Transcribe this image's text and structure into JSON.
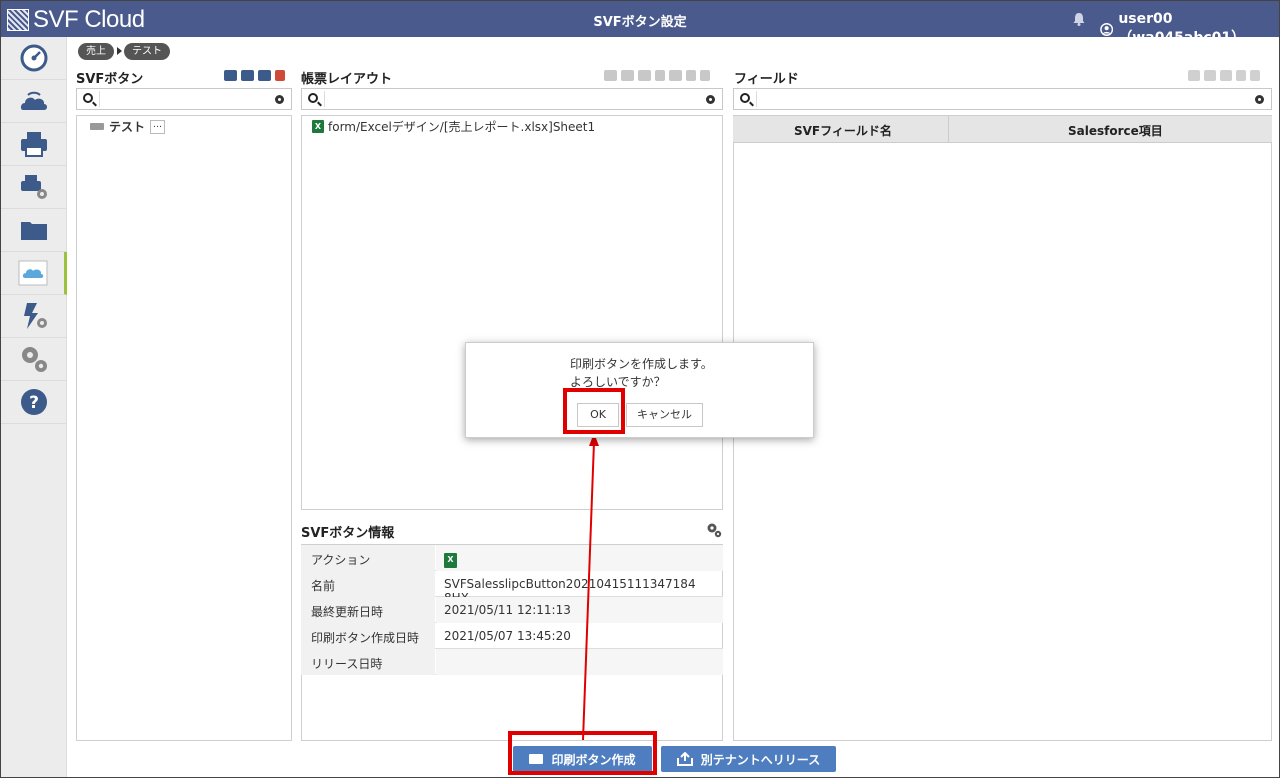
{
  "app": {
    "logo_text": "SVF Cloud",
    "title": "SVFボタン設定",
    "user": "user00（wa045abc01）"
  },
  "nav": {
    "items": [
      {
        "name": "dashboard-icon"
      },
      {
        "name": "cloud-icon"
      },
      {
        "name": "printer-icon"
      },
      {
        "name": "printer-settings-icon"
      },
      {
        "name": "folder-icon"
      },
      {
        "name": "salesforce-icon"
      },
      {
        "name": "flash-settings-icon"
      },
      {
        "name": "gears-icon"
      },
      {
        "name": "help-icon"
      }
    ],
    "active_index": 5
  },
  "breadcrumb": [
    "売上",
    "テスト"
  ],
  "svf_buttons": {
    "title": "SVFボタン",
    "tree_item": "テスト",
    "more": "…"
  },
  "layout": {
    "title": "帳票レイアウト",
    "item": "form/Excelデザイン/[売上レポート.xlsx]Sheet1"
  },
  "fields": {
    "title": "フィールド",
    "col1": "SVFフィールド名",
    "col2": "Salesforce項目"
  },
  "info": {
    "title": "SVFボタン情報",
    "rows": [
      {
        "label": "アクション",
        "value": ""
      },
      {
        "label": "名前",
        "value": "SVFSalesslipcButton20210415111347184 8HX"
      },
      {
        "label": "最終更新日時",
        "value": "2021/05/11 12:11:13"
      },
      {
        "label": "印刷ボタン作成日時",
        "value": "2021/05/07 13:45:20"
      },
      {
        "label": "リリース日時",
        "value": ""
      }
    ]
  },
  "dialog": {
    "line1": "印刷ボタンを作成します。",
    "line2": "よろしいですか？",
    "ok": "OK",
    "cancel": "キャンセル"
  },
  "actions": {
    "create": "印刷ボタン作成",
    "release": "別テナントへリリース"
  },
  "colors": {
    "header": "#4a5a8c",
    "highlight": "#e00000",
    "action_button": "#4f7ec0",
    "active_nav": "#9bc23c"
  }
}
